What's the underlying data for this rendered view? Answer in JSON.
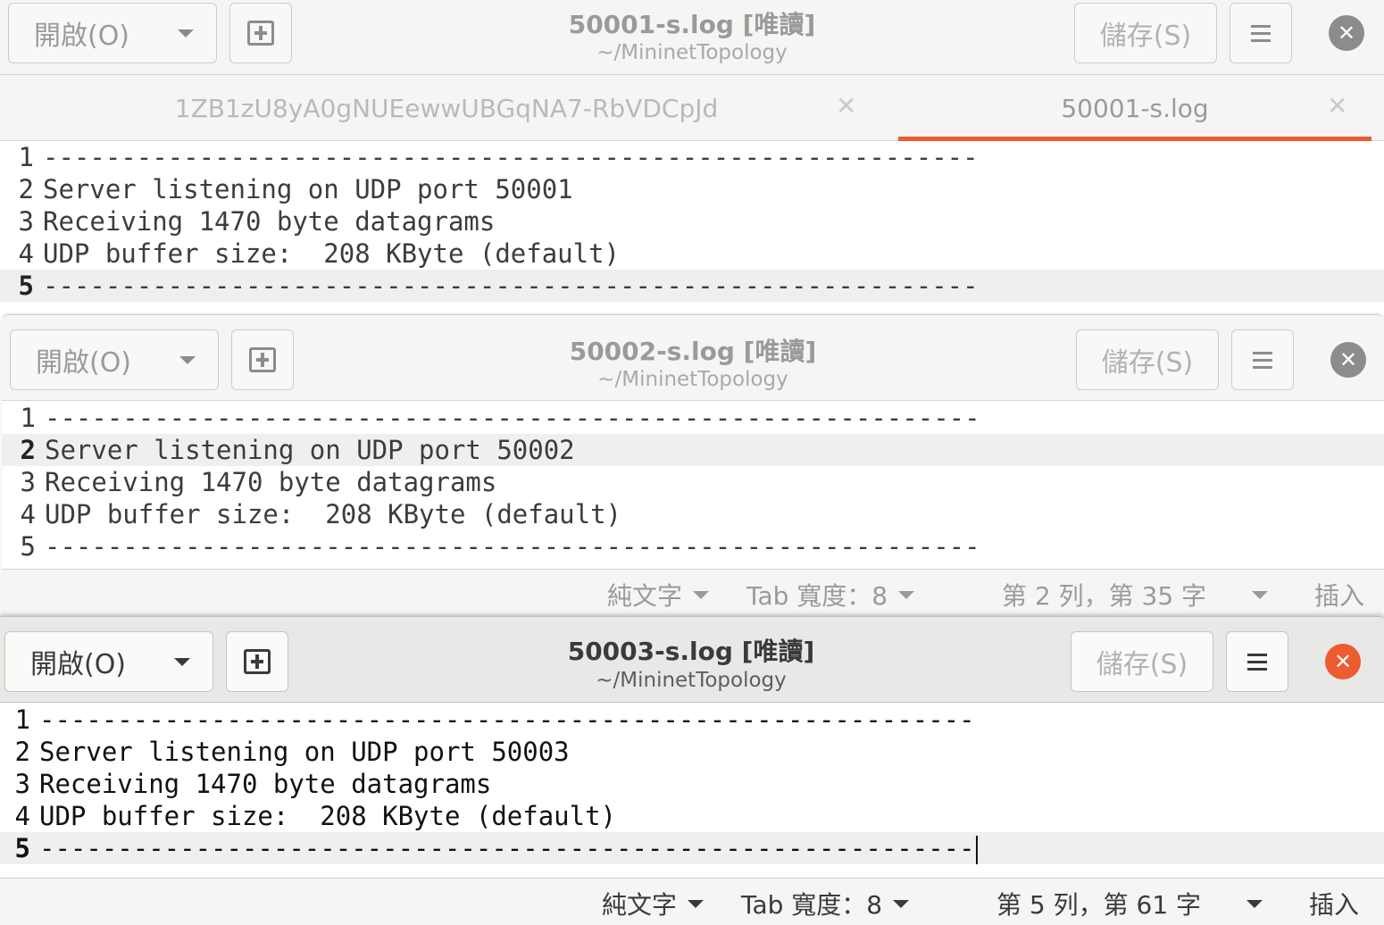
{
  "windows": [
    {
      "title": "50001-s.log [唯讀]",
      "subtitle": "~/MininetTopology",
      "open_label": "開啟(O)",
      "save_label": "儲存(S)",
      "tabs": [
        {
          "label": "1ZB1zU8yA0gNUEewwUBGqNA7-RbVDCpJd",
          "active": false
        },
        {
          "label": "50001-s.log",
          "active": true
        }
      ],
      "lines": [
        {
          "num": "1",
          "text": "------------------------------------------------------------"
        },
        {
          "num": "2",
          "text": "Server listening on UDP port 50001"
        },
        {
          "num": "3",
          "text": "Receiving 1470 byte datagrams"
        },
        {
          "num": "4",
          "text": "UDP buffer size:  208 KByte (default)"
        },
        {
          "num": "5",
          "text": "------------------------------------------------------------"
        }
      ],
      "current_line": 5
    },
    {
      "title": "50002-s.log [唯讀]",
      "subtitle": "~/MininetTopology",
      "open_label": "開啟(O)",
      "save_label": "儲存(S)",
      "lines": [
        {
          "num": "1",
          "text": "------------------------------------------------------------"
        },
        {
          "num": "2",
          "text": "Server listening on UDP port 50002"
        },
        {
          "num": "3",
          "text": "Receiving 1470 byte datagrams"
        },
        {
          "num": "4",
          "text": "UDP buffer size:  208 KByte (default)"
        },
        {
          "num": "5",
          "text": "------------------------------------------------------------"
        }
      ],
      "current_line": 2,
      "status": {
        "language": "純文字",
        "tab_width": "Tab 寬度：8",
        "position": "第 2 列，第 35 字",
        "mode": "插入"
      }
    },
    {
      "title": "50003-s.log [唯讀]",
      "subtitle": "~/MininetTopology",
      "open_label": "開啟(O)",
      "save_label": "儲存(S)",
      "lines": [
        {
          "num": "1",
          "text": "------------------------------------------------------------"
        },
        {
          "num": "2",
          "text": "Server listening on UDP port 50003"
        },
        {
          "num": "3",
          "text": "Receiving 1470 byte datagrams"
        },
        {
          "num": "4",
          "text": "UDP buffer size:  208 KByte (default)"
        },
        {
          "num": "5",
          "text": "------------------------------------------------------------"
        }
      ],
      "current_line": 5,
      "status": {
        "language": "純文字",
        "tab_width": "Tab 寬度：8",
        "position": "第 5 列，第 61 字",
        "mode": "插入"
      }
    }
  ],
  "colors": {
    "accent": "#ed5b30",
    "headerbar": "#f6f5f4",
    "current_line": "#efefee"
  },
  "icons": {
    "new_document": "new-document-icon",
    "menu": "hamburger-menu-icon",
    "close": "close-icon",
    "dropdown": "chevron-down-icon"
  }
}
